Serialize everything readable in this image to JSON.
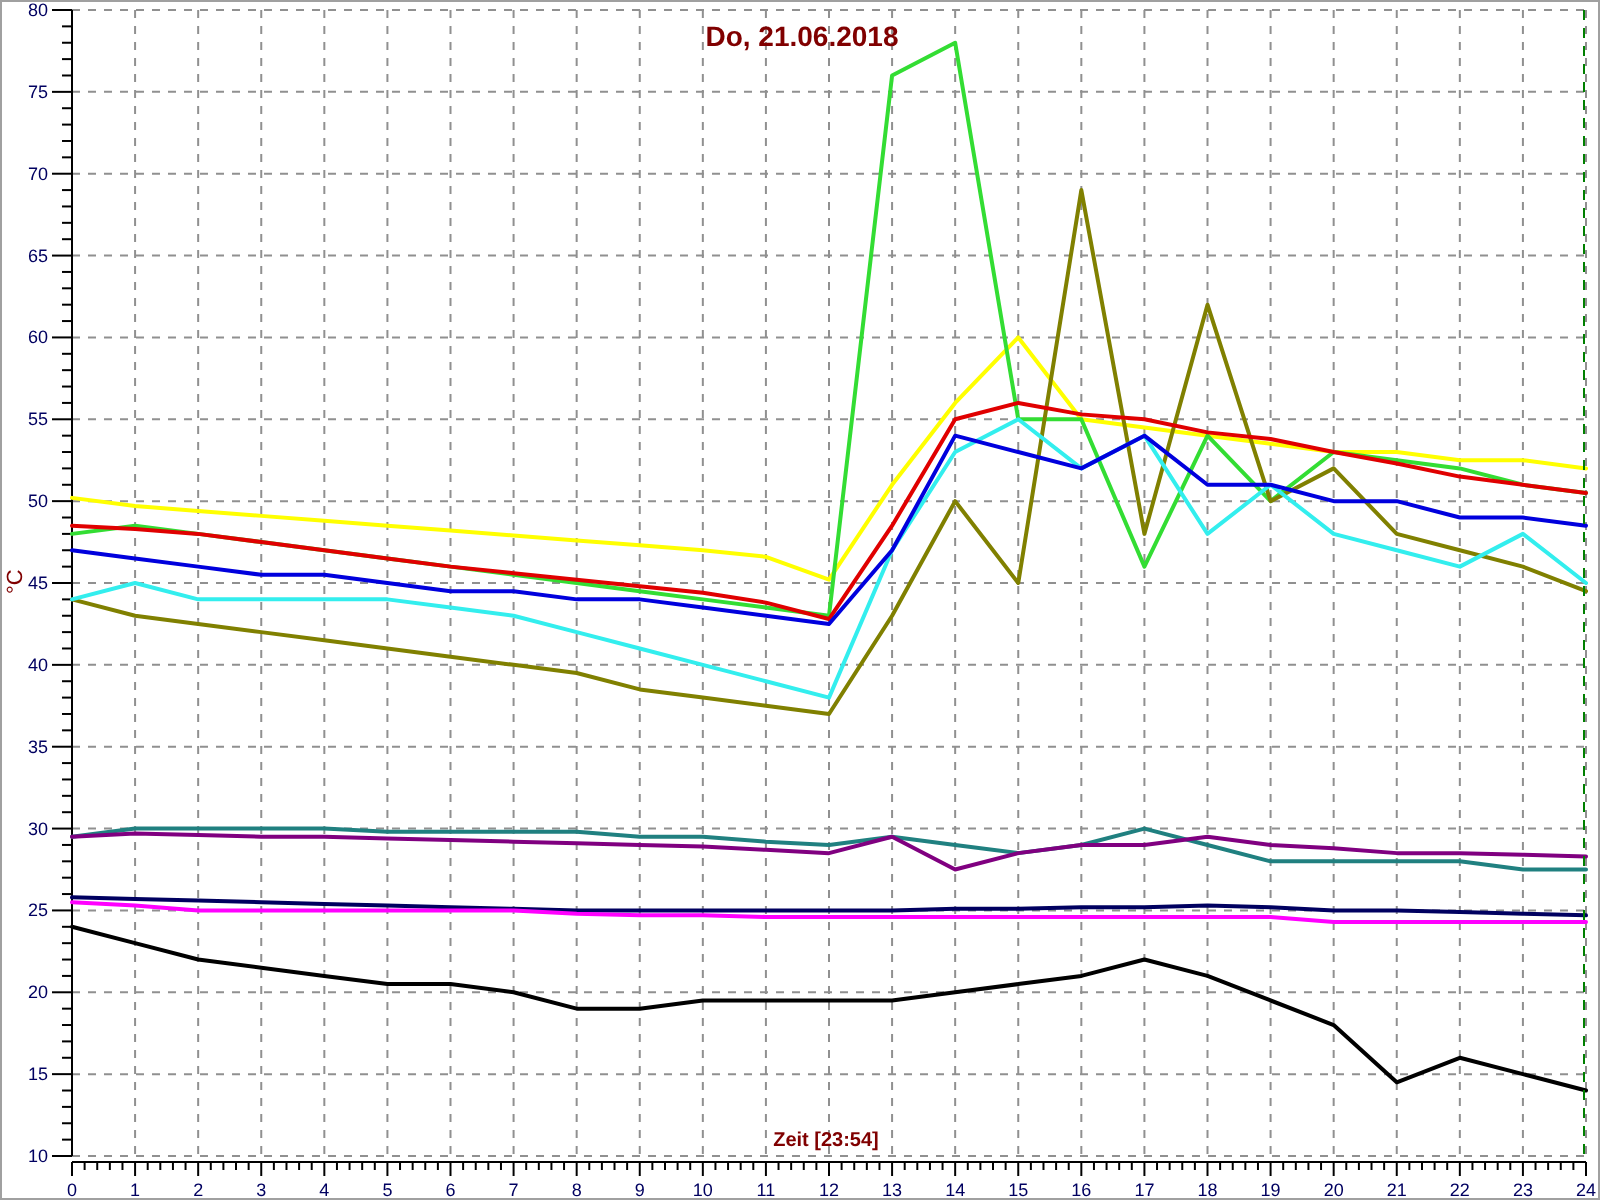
{
  "chart_data": {
    "type": "line",
    "title": "Do, 21.06.2018",
    "xlabel": "Zeit [23:54]",
    "ylabel": "°C",
    "x": [
      0,
      1,
      2,
      3,
      4,
      5,
      6,
      7,
      8,
      9,
      10,
      11,
      12,
      13,
      14,
      15,
      16,
      17,
      18,
      19,
      20,
      21,
      22,
      23,
      24
    ],
    "grid": true,
    "xlim": [
      0,
      24
    ],
    "ylim": [
      10,
      80
    ],
    "xticks": [
      0,
      1,
      2,
      3,
      4,
      5,
      6,
      7,
      8,
      9,
      10,
      11,
      12,
      13,
      14,
      15,
      16,
      17,
      18,
      19,
      20,
      21,
      22,
      23,
      24
    ],
    "yticks": [
      10,
      15,
      20,
      25,
      30,
      35,
      40,
      45,
      50,
      55,
      60,
      65,
      70,
      75,
      80
    ],
    "series": [
      {
        "color": "#ffff00",
        "values": [
          50.2,
          49.7,
          49.4,
          49.1,
          48.8,
          48.5,
          48.2,
          47.9,
          47.6,
          47.3,
          47,
          46.6,
          45.2,
          51,
          56,
          60,
          55,
          54.5,
          54,
          53.5,
          53,
          53,
          52.5,
          52.5,
          52
        ]
      },
      {
        "color": "#33dd33",
        "values": [
          48,
          48.5,
          48,
          47.5,
          47,
          46.5,
          46,
          45.5,
          45,
          44.5,
          44,
          43.5,
          43,
          76,
          78,
          55,
          55,
          46,
          54,
          50,
          53,
          52.5,
          52,
          51,
          50.5
        ]
      },
      {
        "color": "#808000",
        "values": [
          44,
          43,
          42.5,
          42,
          41.5,
          41,
          40.5,
          40,
          39.5,
          38.5,
          38,
          37.5,
          37,
          43,
          50,
          45,
          69,
          48,
          62,
          50,
          52,
          48,
          47,
          46,
          44.5
        ]
      },
      {
        "color": "#33eeee",
        "values": [
          44,
          45,
          44,
          44,
          44,
          44,
          43.5,
          43,
          42,
          41,
          40,
          39,
          38,
          47,
          53,
          55,
          52,
          54,
          48,
          51,
          48,
          47,
          46,
          48,
          45
        ]
      },
      {
        "color": "#e00000",
        "values": [
          48.5,
          48.3,
          48,
          47.5,
          47,
          46.5,
          46,
          45.6,
          45.2,
          44.8,
          44.4,
          43.8,
          42.8,
          48.5,
          55,
          56,
          55.3,
          55,
          54.2,
          53.8,
          53,
          52.3,
          51.5,
          51,
          50.5
        ]
      },
      {
        "color": "#0000dd",
        "values": [
          47,
          46.5,
          46,
          45.5,
          45.5,
          45,
          44.5,
          44.5,
          44,
          44,
          43.5,
          43,
          42.5,
          47,
          54,
          53,
          52,
          54,
          51,
          51,
          50,
          50,
          49,
          49,
          48.5
        ]
      },
      {
        "color": "#208080",
        "values": [
          29.5,
          30,
          30,
          30,
          30,
          29.8,
          29.8,
          29.8,
          29.8,
          29.5,
          29.5,
          29.2,
          29,
          29.5,
          29,
          28.5,
          29,
          30,
          29,
          28,
          28,
          28,
          28,
          27.5,
          27.5
        ]
      },
      {
        "color": "#800080",
        "values": [
          29.5,
          29.7,
          29.6,
          29.5,
          29.5,
          29.4,
          29.3,
          29.2,
          29.1,
          29,
          28.9,
          28.7,
          28.5,
          29.5,
          27.5,
          28.5,
          29,
          29,
          29.5,
          29,
          28.8,
          28.5,
          28.5,
          28.4,
          28.3
        ]
      },
      {
        "color": "#000060",
        "values": [
          25.8,
          25.7,
          25.6,
          25.5,
          25.4,
          25.3,
          25.2,
          25.1,
          25,
          25,
          25,
          25,
          25,
          25,
          25.1,
          25.1,
          25.2,
          25.2,
          25.3,
          25.2,
          25,
          25,
          24.9,
          24.8,
          24.7
        ]
      },
      {
        "color": "#ff00ff",
        "values": [
          25.5,
          25.3,
          25,
          25,
          25,
          25,
          25,
          25,
          24.8,
          24.7,
          24.7,
          24.6,
          24.6,
          24.6,
          24.6,
          24.6,
          24.6,
          24.6,
          24.6,
          24.6,
          24.3,
          24.3,
          24.3,
          24.3,
          24.3
        ]
      },
      {
        "color": "#000000",
        "values": [
          24,
          23,
          22,
          21.5,
          21,
          20.5,
          20.5,
          20,
          19,
          19,
          19.5,
          19.5,
          19.5,
          19.5,
          20,
          20.5,
          21,
          22,
          21,
          19.5,
          18,
          14.5,
          16,
          15,
          14
        ]
      }
    ]
  }
}
